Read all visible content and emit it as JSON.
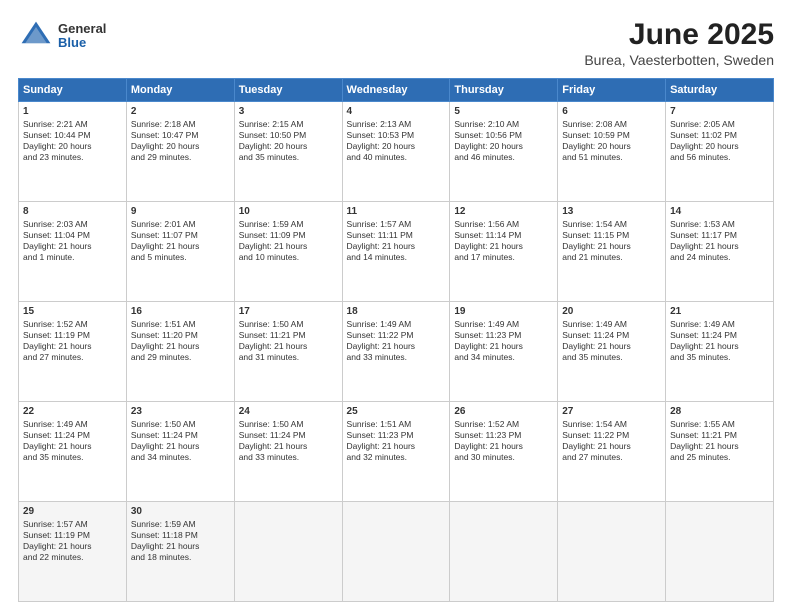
{
  "logo": {
    "general": "General",
    "blue": "Blue"
  },
  "title": "June 2025",
  "subtitle": "Burea, Vaesterbotten, Sweden",
  "header_days": [
    "Sunday",
    "Monday",
    "Tuesday",
    "Wednesday",
    "Thursday",
    "Friday",
    "Saturday"
  ],
  "weeks": [
    [
      {
        "day": "1",
        "lines": [
          "Sunrise: 2:21 AM",
          "Sunset: 10:44 PM",
          "Daylight: 20 hours",
          "and 23 minutes."
        ]
      },
      {
        "day": "2",
        "lines": [
          "Sunrise: 2:18 AM",
          "Sunset: 10:47 PM",
          "Daylight: 20 hours",
          "and 29 minutes."
        ]
      },
      {
        "day": "3",
        "lines": [
          "Sunrise: 2:15 AM",
          "Sunset: 10:50 PM",
          "Daylight: 20 hours",
          "and 35 minutes."
        ]
      },
      {
        "day": "4",
        "lines": [
          "Sunrise: 2:13 AM",
          "Sunset: 10:53 PM",
          "Daylight: 20 hours",
          "and 40 minutes."
        ]
      },
      {
        "day": "5",
        "lines": [
          "Sunrise: 2:10 AM",
          "Sunset: 10:56 PM",
          "Daylight: 20 hours",
          "and 46 minutes."
        ]
      },
      {
        "day": "6",
        "lines": [
          "Sunrise: 2:08 AM",
          "Sunset: 10:59 PM",
          "Daylight: 20 hours",
          "and 51 minutes."
        ]
      },
      {
        "day": "7",
        "lines": [
          "Sunrise: 2:05 AM",
          "Sunset: 11:02 PM",
          "Daylight: 20 hours",
          "and 56 minutes."
        ]
      }
    ],
    [
      {
        "day": "8",
        "lines": [
          "Sunrise: 2:03 AM",
          "Sunset: 11:04 PM",
          "Daylight: 21 hours",
          "and 1 minute."
        ]
      },
      {
        "day": "9",
        "lines": [
          "Sunrise: 2:01 AM",
          "Sunset: 11:07 PM",
          "Daylight: 21 hours",
          "and 5 minutes."
        ]
      },
      {
        "day": "10",
        "lines": [
          "Sunrise: 1:59 AM",
          "Sunset: 11:09 PM",
          "Daylight: 21 hours",
          "and 10 minutes."
        ]
      },
      {
        "day": "11",
        "lines": [
          "Sunrise: 1:57 AM",
          "Sunset: 11:11 PM",
          "Daylight: 21 hours",
          "and 14 minutes."
        ]
      },
      {
        "day": "12",
        "lines": [
          "Sunrise: 1:56 AM",
          "Sunset: 11:14 PM",
          "Daylight: 21 hours",
          "and 17 minutes."
        ]
      },
      {
        "day": "13",
        "lines": [
          "Sunrise: 1:54 AM",
          "Sunset: 11:15 PM",
          "Daylight: 21 hours",
          "and 21 minutes."
        ]
      },
      {
        "day": "14",
        "lines": [
          "Sunrise: 1:53 AM",
          "Sunset: 11:17 PM",
          "Daylight: 21 hours",
          "and 24 minutes."
        ]
      }
    ],
    [
      {
        "day": "15",
        "lines": [
          "Sunrise: 1:52 AM",
          "Sunset: 11:19 PM",
          "Daylight: 21 hours",
          "and 27 minutes."
        ]
      },
      {
        "day": "16",
        "lines": [
          "Sunrise: 1:51 AM",
          "Sunset: 11:20 PM",
          "Daylight: 21 hours",
          "and 29 minutes."
        ]
      },
      {
        "day": "17",
        "lines": [
          "Sunrise: 1:50 AM",
          "Sunset: 11:21 PM",
          "Daylight: 21 hours",
          "and 31 minutes."
        ]
      },
      {
        "day": "18",
        "lines": [
          "Sunrise: 1:49 AM",
          "Sunset: 11:22 PM",
          "Daylight: 21 hours",
          "and 33 minutes."
        ]
      },
      {
        "day": "19",
        "lines": [
          "Sunrise: 1:49 AM",
          "Sunset: 11:23 PM",
          "Daylight: 21 hours",
          "and 34 minutes."
        ]
      },
      {
        "day": "20",
        "lines": [
          "Sunrise: 1:49 AM",
          "Sunset: 11:24 PM",
          "Daylight: 21 hours",
          "and 35 minutes."
        ]
      },
      {
        "day": "21",
        "lines": [
          "Sunrise: 1:49 AM",
          "Sunset: 11:24 PM",
          "Daylight: 21 hours",
          "and 35 minutes."
        ]
      }
    ],
    [
      {
        "day": "22",
        "lines": [
          "Sunrise: 1:49 AM",
          "Sunset: 11:24 PM",
          "Daylight: 21 hours",
          "and 35 minutes."
        ]
      },
      {
        "day": "23",
        "lines": [
          "Sunrise: 1:50 AM",
          "Sunset: 11:24 PM",
          "Daylight: 21 hours",
          "and 34 minutes."
        ]
      },
      {
        "day": "24",
        "lines": [
          "Sunrise: 1:50 AM",
          "Sunset: 11:24 PM",
          "Daylight: 21 hours",
          "and 33 minutes."
        ]
      },
      {
        "day": "25",
        "lines": [
          "Sunrise: 1:51 AM",
          "Sunset: 11:23 PM",
          "Daylight: 21 hours",
          "and 32 minutes."
        ]
      },
      {
        "day": "26",
        "lines": [
          "Sunrise: 1:52 AM",
          "Sunset: 11:23 PM",
          "Daylight: 21 hours",
          "and 30 minutes."
        ]
      },
      {
        "day": "27",
        "lines": [
          "Sunrise: 1:54 AM",
          "Sunset: 11:22 PM",
          "Daylight: 21 hours",
          "and 27 minutes."
        ]
      },
      {
        "day": "28",
        "lines": [
          "Sunrise: 1:55 AM",
          "Sunset: 11:21 PM",
          "Daylight: 21 hours",
          "and 25 minutes."
        ]
      }
    ],
    [
      {
        "day": "29",
        "lines": [
          "Sunrise: 1:57 AM",
          "Sunset: 11:19 PM",
          "Daylight: 21 hours",
          "and 22 minutes."
        ]
      },
      {
        "day": "30",
        "lines": [
          "Sunrise: 1:59 AM",
          "Sunset: 11:18 PM",
          "Daylight: 21 hours",
          "and 18 minutes."
        ]
      },
      null,
      null,
      null,
      null,
      null
    ]
  ]
}
